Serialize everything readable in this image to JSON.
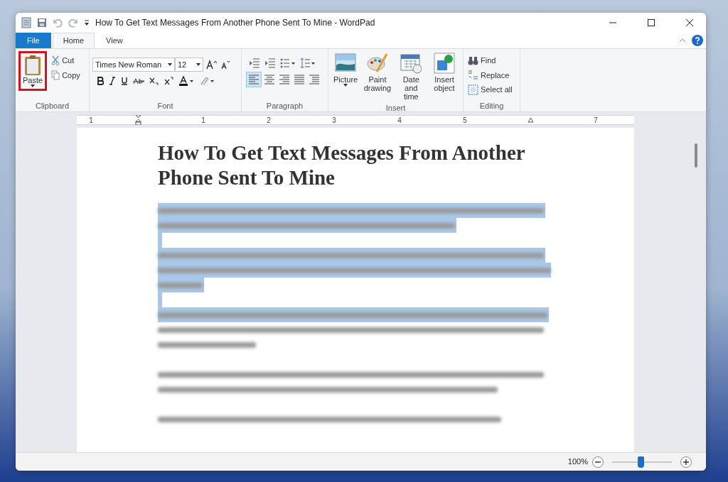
{
  "window": {
    "title": "How To Get Text Messages From Another Phone Sent To Mine - WordPad"
  },
  "tabs": [
    {
      "label": "File",
      "kind": "file",
      "selected": false
    },
    {
      "label": "Home",
      "kind": "tab",
      "selected": true
    },
    {
      "label": "View",
      "kind": "tab",
      "selected": false
    }
  ],
  "ribbon": {
    "clipboard": {
      "label": "Clipboard",
      "paste": "Paste",
      "paste_highlighted": true,
      "cut": "Cut",
      "copy": "Copy"
    },
    "font": {
      "label": "Font",
      "family": "Times New Roman",
      "size": "12"
    },
    "paragraph": {
      "label": "Paragraph"
    },
    "insert": {
      "label": "Insert",
      "items": [
        {
          "label": "Picture",
          "kind": "picture"
        },
        {
          "label": "Paint drawing",
          "kind": "paint"
        },
        {
          "label": "Date and time",
          "kind": "date"
        },
        {
          "label": "Insert object",
          "kind": "object"
        }
      ]
    },
    "editing": {
      "label": "Editing",
      "items": [
        {
          "label": "Find",
          "kind": "find"
        },
        {
          "label": "Replace",
          "kind": "replace"
        },
        {
          "label": "Select all",
          "kind": "selectall"
        }
      ]
    }
  },
  "ruler": [
    {
      "kind": "number",
      "label": "1"
    },
    {
      "kind": "indent"
    },
    {
      "kind": "number",
      "label": "1"
    },
    {
      "kind": "number",
      "label": "2"
    },
    {
      "kind": "number",
      "label": "3"
    },
    {
      "kind": "number",
      "label": "4"
    },
    {
      "kind": "number",
      "label": "5"
    },
    {
      "kind": "margin"
    },
    {
      "kind": "number",
      "label": "7"
    }
  ],
  "document": {
    "heading": "How To Get Text Messages From Another Phone Sent To Mine",
    "lines": [
      {
        "kind": "text",
        "selected": true
      },
      {
        "kind": "text",
        "selected": true
      },
      {
        "kind": "blank",
        "selected": true
      },
      {
        "kind": "text",
        "selected": true
      },
      {
        "kind": "text",
        "selected": true
      },
      {
        "kind": "text",
        "selected": true
      },
      {
        "kind": "blank",
        "selected": true
      },
      {
        "kind": "text",
        "selected": true
      },
      {
        "kind": "text",
        "selected": false
      },
      {
        "kind": "text",
        "selected": false
      },
      {
        "kind": "blank"
      },
      {
        "kind": "text",
        "selected": false
      },
      {
        "kind": "text",
        "selected": false
      },
      {
        "kind": "blank"
      },
      {
        "kind": "text",
        "selected": false
      }
    ]
  },
  "status_bar": {
    "zoom": "100%",
    "level": 0.48
  }
}
